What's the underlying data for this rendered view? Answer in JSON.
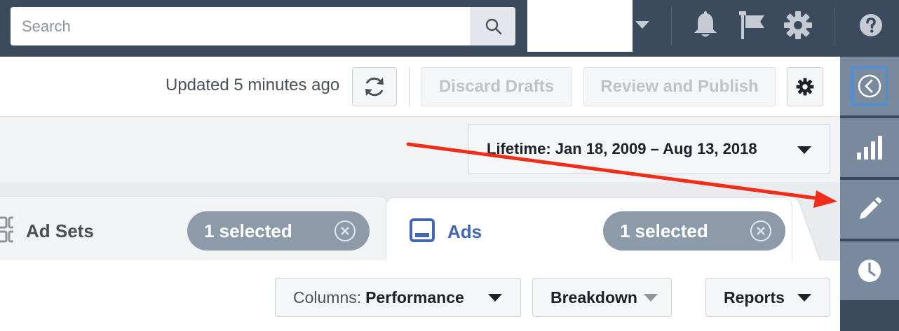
{
  "topbar": {
    "search_placeholder": "Search",
    "icons": [
      "search-icon",
      "notification-bell-icon",
      "flag-icon",
      "gear-icon",
      "help-icon"
    ]
  },
  "toolbar": {
    "updated_text": "Updated 5 minutes ago",
    "discard_label": "Discard Drafts",
    "review_label": "Review and Publish"
  },
  "date_range": {
    "label": "Lifetime: Jan 18, 2009 – Aug 13, 2018"
  },
  "tabs": [
    {
      "label": "Ad Sets",
      "selected_text": "1 selected",
      "active": false
    },
    {
      "label": "Ads",
      "selected_text": "1 selected",
      "active": true
    }
  ],
  "controls": {
    "columns_label": "Columns:",
    "columns_value": "Performance",
    "breakdown_label": "Breakdown",
    "reports_label": "Reports"
  },
  "rail": {
    "items": [
      "collapse-icon",
      "chart-bars-icon",
      "pencil-icon",
      "clock-icon"
    ]
  },
  "colors": {
    "topbar": "#3b4a5c",
    "rail_item": "#798a9f",
    "accent_blue": "#4267b2",
    "pill": "#8d9aa9",
    "annotation_arrow": "#f02d18"
  }
}
